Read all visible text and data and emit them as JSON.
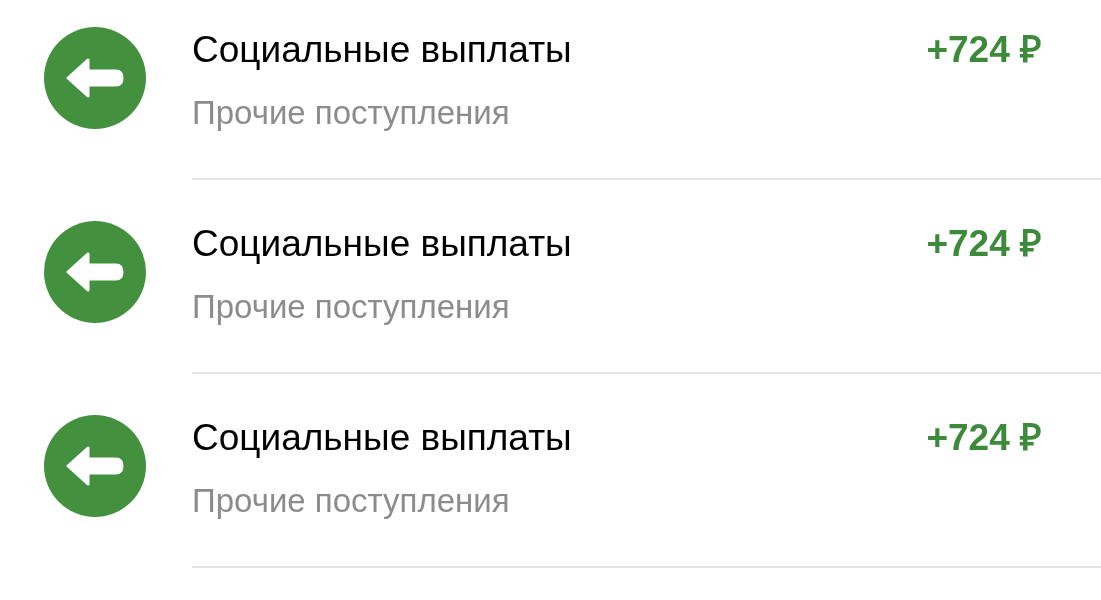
{
  "transactions": [
    {
      "title": "Социальные выплаты",
      "category": "Прочие поступления",
      "amount": "+724 ₽"
    },
    {
      "title": "Социальные выплаты",
      "category": "Прочие поступления",
      "amount": "+724 ₽"
    },
    {
      "title": "Социальные выплаты",
      "category": "Прочие поступления",
      "amount": "+724 ₽"
    }
  ]
}
